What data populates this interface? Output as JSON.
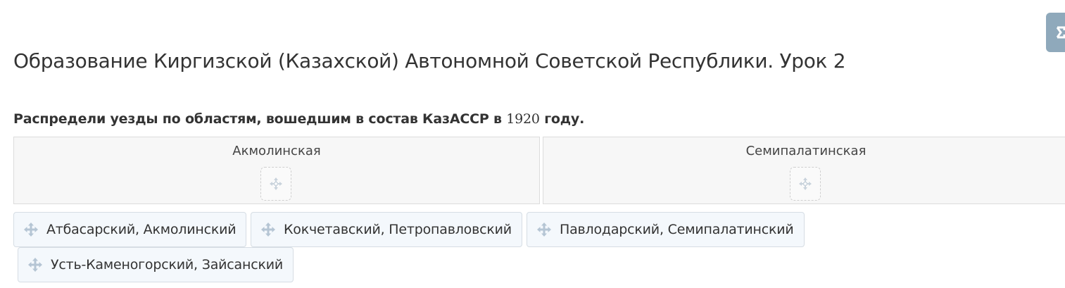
{
  "title": "Образование Киргизской (Казахской) Автономной Советской Республики. Урок 2",
  "task": {
    "text": "Распредели уезды по областям, вошедшим в состав КазАССР в ",
    "year": "1920",
    "suffix": " году."
  },
  "categories": [
    {
      "label": "Акмолинская",
      "drop_icon": "move-icon"
    },
    {
      "label": "Семипалатинская",
      "drop_icon": "move-icon"
    }
  ],
  "items": [
    {
      "label": "Атбасарский, Акмолинский",
      "icon": "move-icon"
    },
    {
      "label": "Кокчетавский, Петропавловский",
      "icon": "move-icon"
    },
    {
      "label": "Павлодарский, Семипалатинский",
      "icon": "move-icon"
    },
    {
      "label": "Усть-Каменогорский, Зайсанский",
      "icon": "move-icon"
    }
  ],
  "colors": {
    "accent": "#8fa9bb",
    "chip_background": "#f4f8fc",
    "icon": "#b5c5d4"
  }
}
